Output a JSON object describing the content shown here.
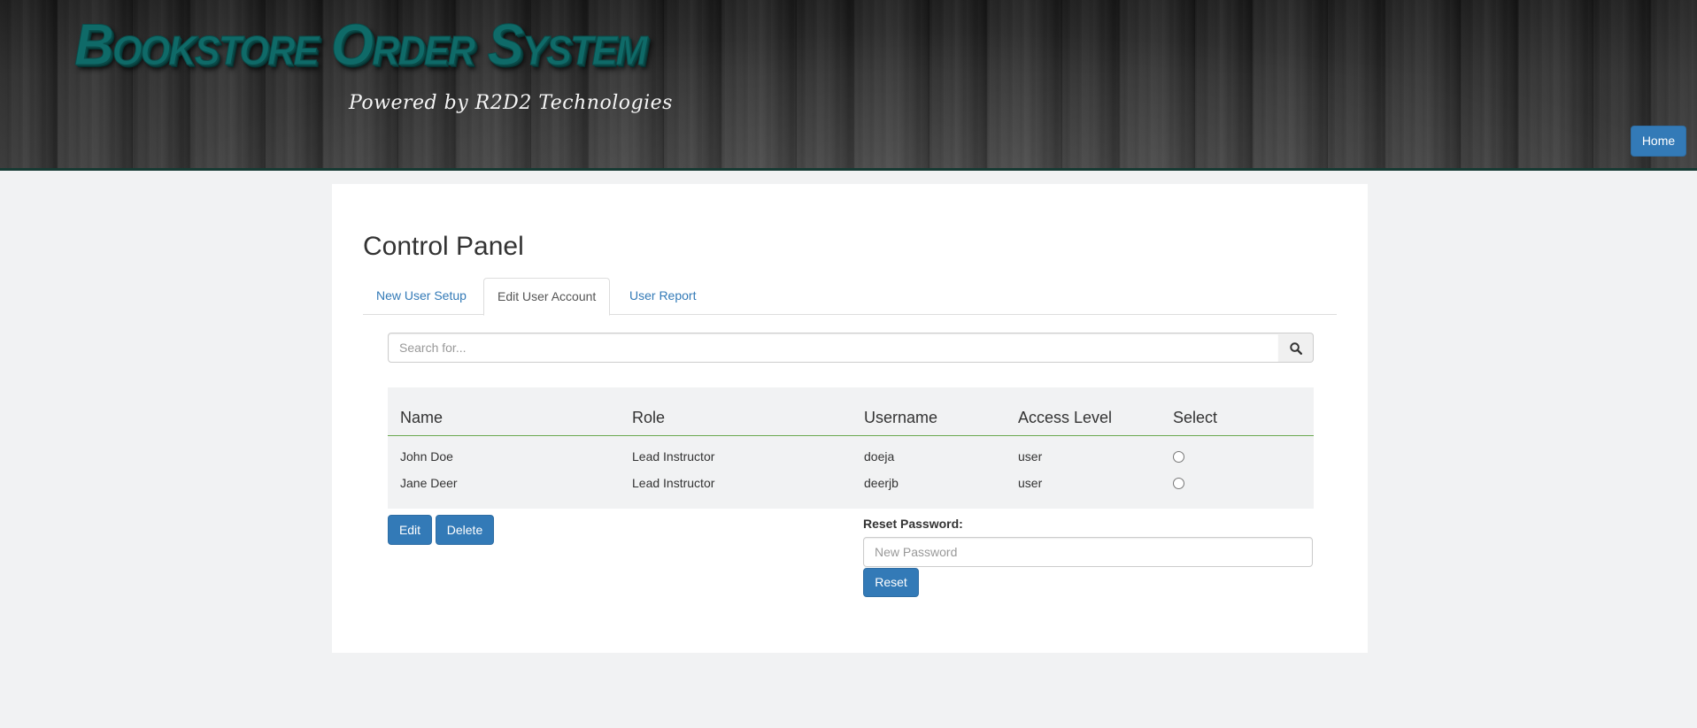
{
  "header": {
    "title": "Bookstore Order System",
    "tagline": "Powered by R2D2 Technologies",
    "home_label": "Home"
  },
  "panel": {
    "title": "Control Panel",
    "tabs": [
      {
        "label": "New User Setup",
        "active": false
      },
      {
        "label": "Edit User Account",
        "active": true
      },
      {
        "label": "User Report",
        "active": false
      }
    ]
  },
  "search": {
    "placeholder": "Search for...",
    "value": "",
    "button_icon": "search-icon"
  },
  "table": {
    "columns": [
      "Name",
      "Role",
      "Username",
      "Access Level",
      "Select"
    ],
    "rows": [
      {
        "name": "John Doe",
        "role": "Lead Instructor",
        "username": "doeja",
        "access": "user",
        "selected": false
      },
      {
        "name": "Jane Deer",
        "role": "Lead Instructor",
        "username": "deerjb",
        "access": "user",
        "selected": false
      }
    ]
  },
  "actions": {
    "edit_label": "Edit",
    "delete_label": "Delete"
  },
  "reset": {
    "label": "Reset Password:",
    "placeholder": "New Password",
    "value": "",
    "button_label": "Reset"
  },
  "colors": {
    "primary": "#337ab7",
    "logo_teal": "#0f6a68",
    "table_header_border": "#6aa84f",
    "page_bg": "#f1f2f3"
  }
}
